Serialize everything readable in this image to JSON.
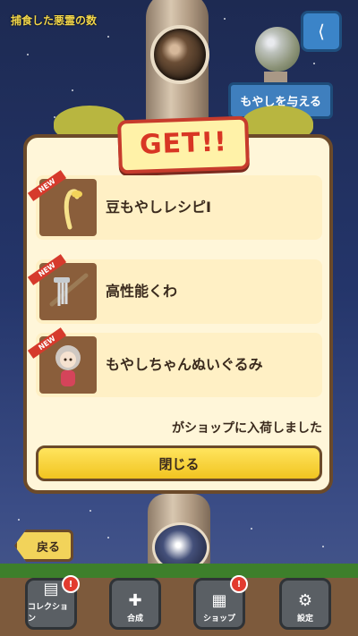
{
  "header": {
    "left_text": "捕食した悪霊の数"
  },
  "buttons": {
    "share_label": "<",
    "feed_label": "もやしを与える",
    "back_label": "戻る",
    "close_label": "閉じる"
  },
  "popup": {
    "title": "GET!!",
    "items": [
      {
        "name": "豆もやしレシピI",
        "new_tag": "NEW",
        "icon": "bean-sprout-icon"
      },
      {
        "name": "高性能くわ",
        "new_tag": "NEW",
        "icon": "hoe-icon"
      },
      {
        "name": "もやしちゃんぬいぐるみ",
        "new_tag": "NEW",
        "icon": "doll-icon"
      }
    ],
    "notice": "がショップに入荷しました"
  },
  "nav": [
    {
      "label": "コレクション",
      "icon": "collection-icon",
      "has_badge": true,
      "badge": "!"
    },
    {
      "label": "合成",
      "icon": "compose-icon",
      "has_badge": false
    },
    {
      "label": "ショップ",
      "icon": "shop-icon",
      "has_badge": true,
      "badge": "!"
    },
    {
      "label": "設定",
      "icon": "gear-icon",
      "has_badge": false
    }
  ]
}
